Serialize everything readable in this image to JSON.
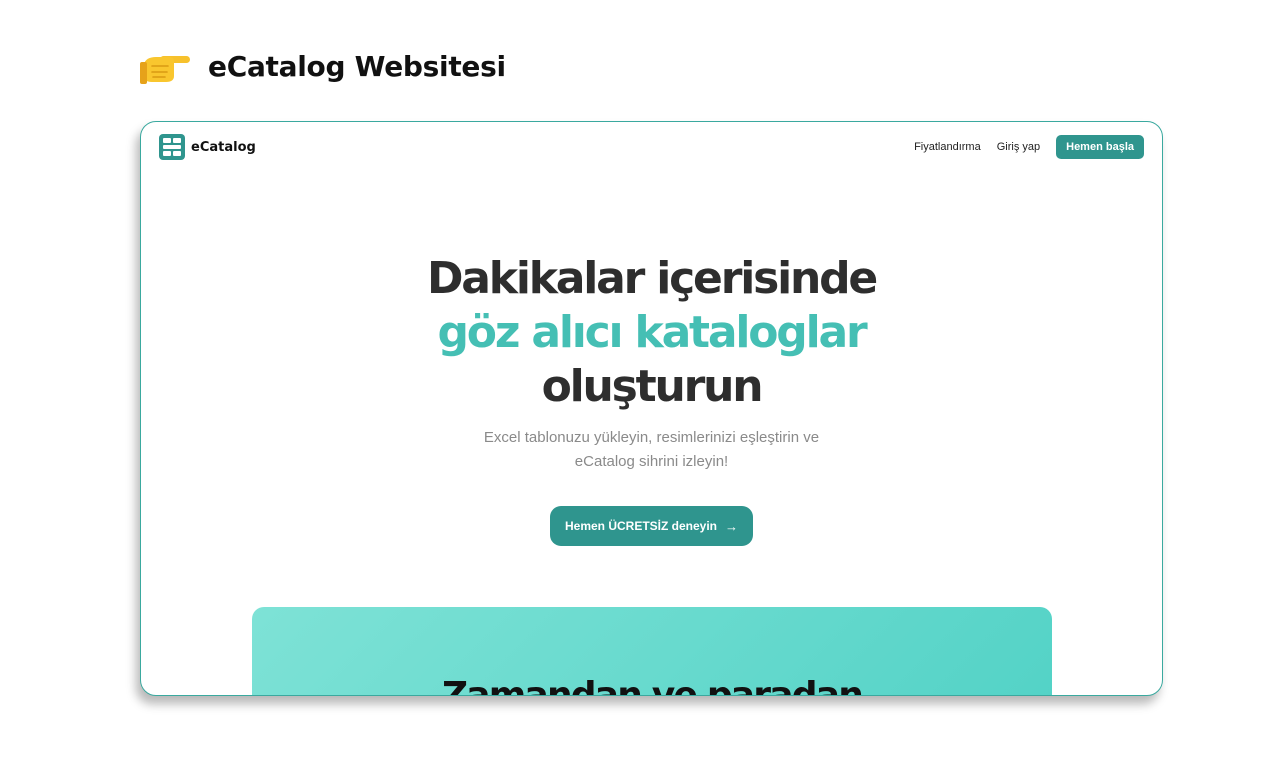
{
  "page": {
    "title": "eCatalog Websitesi",
    "icon": "pointing-right-hand-icon"
  },
  "nav": {
    "brand": "eCatalog",
    "brand_icon": "table-grid-icon",
    "links": [
      "Fiyatlandırma",
      "Giriş yap"
    ],
    "cta": "Hemen başla"
  },
  "hero": {
    "line1": "Dakikalar içerisinde",
    "line2": "göz alıcı kataloglar",
    "line3": "oluşturun",
    "subtitle_line1": "Excel tablonuzu yükleyin, resimlerinizi eşleştirin ve",
    "subtitle_line2": "eCatalog sihrini izleyin!",
    "cta": "Hemen ÜCRETSİZ deneyin",
    "cta_icon": "arrow-right-icon"
  },
  "promo": {
    "heading": "Zamandan ve paradan"
  },
  "colors": {
    "accent": "#45bfb4",
    "button": "#2f958e",
    "frame_border": "#3aa99f",
    "heading": "#2e2e2e",
    "subtitle": "#8a8a8a"
  }
}
